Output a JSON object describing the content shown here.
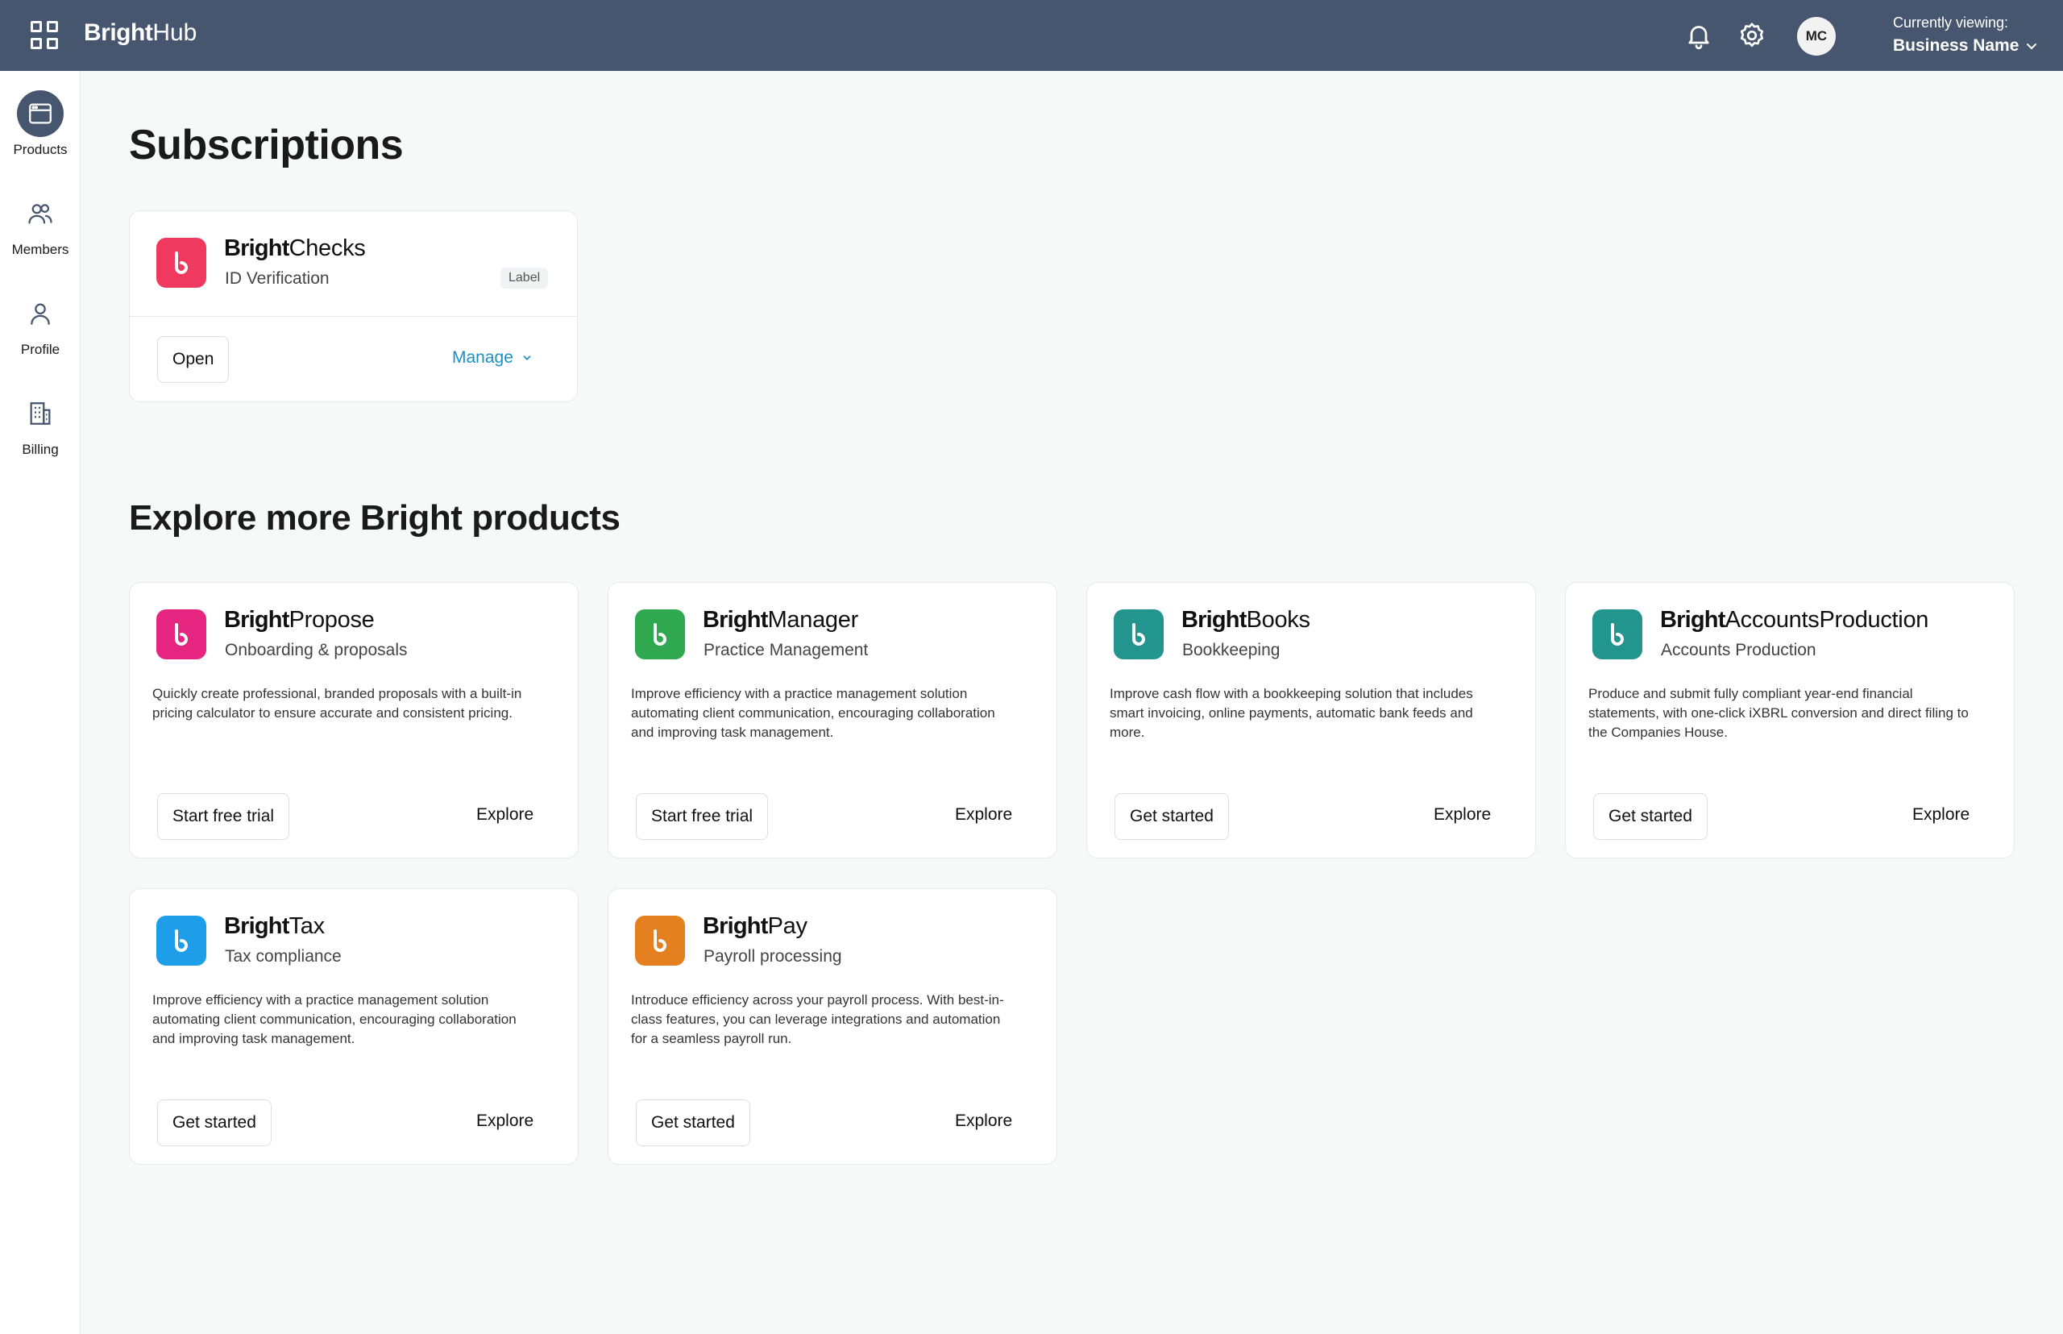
{
  "header": {
    "brand_bold": "Bright",
    "brand_light": "Hub",
    "avatar_initials": "MC",
    "viewing_label": "Currently viewing:",
    "business_name": "Business Name"
  },
  "sidebar": {
    "items": [
      {
        "label": "Products",
        "icon": "browser-window-icon",
        "active": true
      },
      {
        "label": "Members",
        "icon": "users-icon"
      },
      {
        "label": "Profile",
        "icon": "user-icon"
      },
      {
        "label": "Billing",
        "icon": "building-icon"
      }
    ]
  },
  "subscriptions": {
    "title": "Subscriptions",
    "card": {
      "brand": "Bright",
      "product": "Checks",
      "subtitle": "ID Verification",
      "badge": "Label",
      "open_label": "Open",
      "manage_label": "Manage",
      "color": "#f0395e"
    }
  },
  "explore": {
    "title": "Explore more Bright products",
    "products": [
      {
        "brand": "Bright",
        "product": "Propose",
        "subtitle": "Onboarding & proposals",
        "description": "Quickly create professional, branded proposals with a built-in pricing calculator to ensure accurate and consistent pricing.",
        "primary": "Start free trial",
        "secondary": "Explore",
        "color": "#e5257f"
      },
      {
        "brand": "Bright",
        "product": "Manager",
        "subtitle": "Practice Management",
        "description": "Improve efficiency with a practice management solution automating client communication, encouraging collaboration and improving task management.",
        "primary": "Start free trial",
        "secondary": "Explore",
        "color": "#2fa84f"
      },
      {
        "brand": "Bright",
        "product": "Books",
        "subtitle": "Bookkeeping",
        "description": "Improve cash flow with a bookkeeping solution that includes smart invoicing, online payments, automatic bank feeds and more.",
        "primary": "Get started",
        "secondary": "Explore",
        "color": "#22958f"
      },
      {
        "brand": "Bright",
        "product": "AccountsProduction",
        "subtitle": "Accounts Production",
        "description": "Produce and submit fully compliant year-end financial statements, with one-click iXBRL conversion and direct filing to the Companies House.",
        "primary": "Get started",
        "secondary": "Explore",
        "color": "#22958f"
      },
      {
        "brand": "Bright",
        "product": "Tax",
        "subtitle": "Tax compliance",
        "description": "Improve efficiency with a practice management solution automating client communication, encouraging collaboration and improving task management.",
        "primary": "Get started",
        "secondary": "Explore",
        "color": "#1e9de8"
      },
      {
        "brand": "Bright",
        "product": "Pay",
        "subtitle": "Payroll processing",
        "description": "Introduce efficiency across your payroll process. With best-in-class features, you can leverage integrations and automation for a seamless payroll run.",
        "primary": "Get started",
        "secondary": "Explore",
        "color": "#e4801f"
      }
    ]
  }
}
